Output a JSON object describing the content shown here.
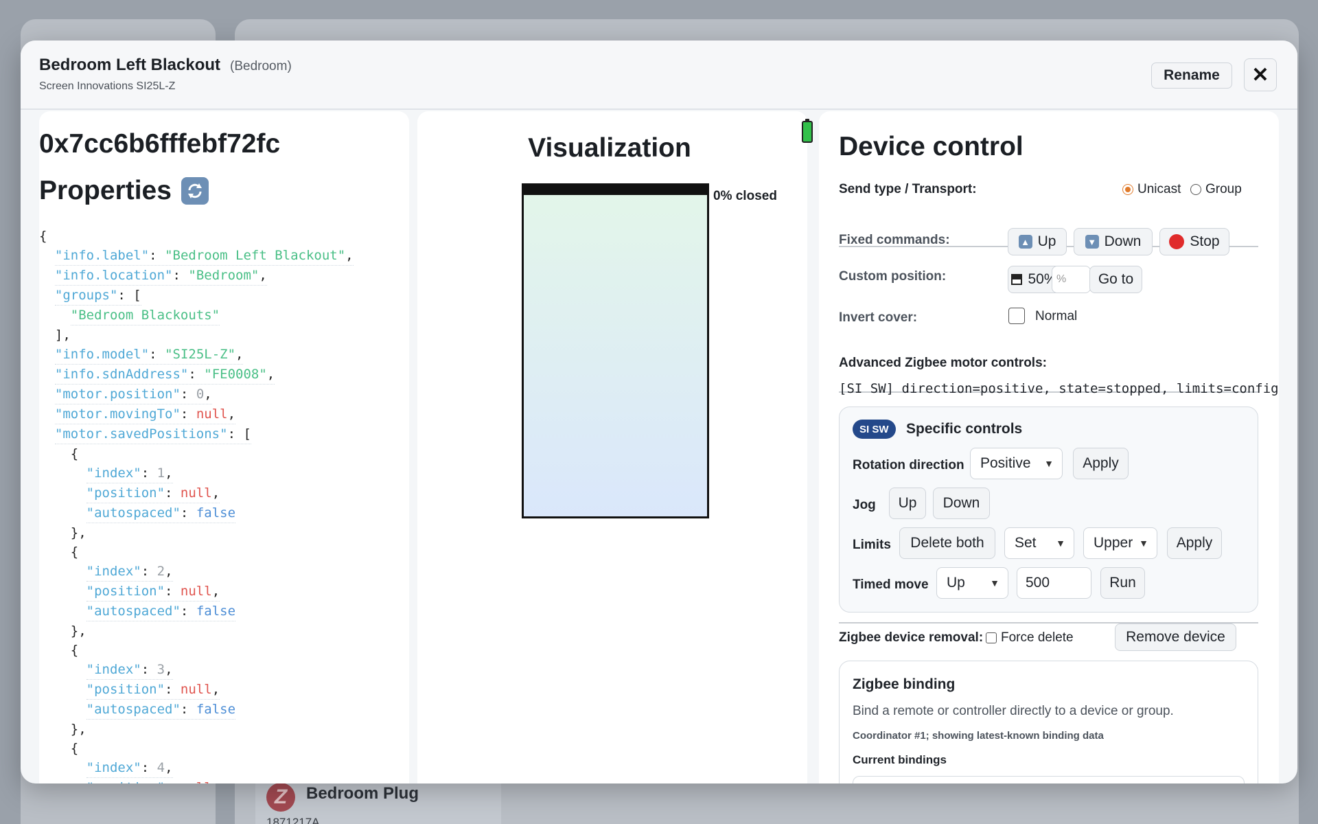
{
  "background": {
    "plug_name": "Bedroom Plug",
    "plug_id": "1871217A",
    "plug_icon": "zigbee-icon"
  },
  "header": {
    "title": "Bedroom Left Blackout",
    "room": "(Bedroom)",
    "subtitle": "Screen Innovations SI25L-Z",
    "rename_label": "Rename",
    "close_label": "✕"
  },
  "properties": {
    "device_id": "0x7cc6b6fffebf72fc",
    "heading": "Properties",
    "refresh_icon": "refresh-icon"
  },
  "visualization": {
    "title": "Visualization",
    "closed_label": "0% closed",
    "battery_icon": "battery-full-icon",
    "position_closed_percent": 0
  },
  "control": {
    "title": "Device control",
    "send_type_label": "Send type / Transport:",
    "unicast_label": "Unicast",
    "group_label": "Group",
    "fixed_label": "Fixed commands:",
    "up_label": "Up",
    "down_label": "Down",
    "stop_label": "Stop",
    "custom_label": "Custom position:",
    "preset_label": "50%",
    "pct_placeholder": "%",
    "goto_label": "Go to",
    "invert_label": "Invert cover:",
    "normal_label": "Normal",
    "advanced_label": "Advanced Zigbee motor controls:",
    "status_line": "[SI SW] direction=positive, state=stopped, limits=configu",
    "specific": {
      "badge": "SI SW",
      "title": "Specific controls",
      "rotation_label": "Rotation direction",
      "rotation_value": "Positive",
      "apply_label": "Apply",
      "jog_label": "Jog",
      "jog_up": "Up",
      "jog_down": "Down",
      "limits_label": "Limits",
      "delete_both": "Delete both",
      "limits_action": "Set",
      "limits_which": "Upper",
      "timed_label": "Timed move",
      "timed_dir": "Up",
      "timed_ms": "500",
      "run_label": "Run"
    },
    "removal_label": "Zigbee device removal:",
    "force_delete_label": "Force delete",
    "remove_device_label": "Remove device",
    "binding": {
      "title": "Zigbee binding",
      "description": "Bind a remote or controller directly to a device or group.",
      "note": "Coordinator #1; showing latest-known binding data",
      "current_label": "Current bindings"
    }
  },
  "json_lines": [
    "{",
    "  \"info.label\": \"Bedroom Left Blackout\",",
    "  \"info.location\": \"Bedroom\",",
    "  \"groups\": [",
    "    \"Bedroom Blackouts\"",
    "  ],",
    "  \"info.model\": \"SI25L-Z\",",
    "  \"info.sdnAddress\": \"FE0008\",",
    "  \"motor.position\": 0,",
    "  \"motor.movingTo\": null,",
    "  \"motor.savedPositions\": [",
    "    {",
    "      \"index\": 1,",
    "      \"position\": null,",
    "      \"autospaced\": false",
    "    },",
    "    {",
    "      \"index\": 2,",
    "      \"position\": null,",
    "      \"autospaced\": false",
    "    },",
    "    {",
    "      \"index\": 3,",
    "      \"position\": null,",
    "      \"autospaced\": false",
    "    },",
    "    {",
    "      \"index\": 4,",
    "      \"position\": null,"
  ]
}
